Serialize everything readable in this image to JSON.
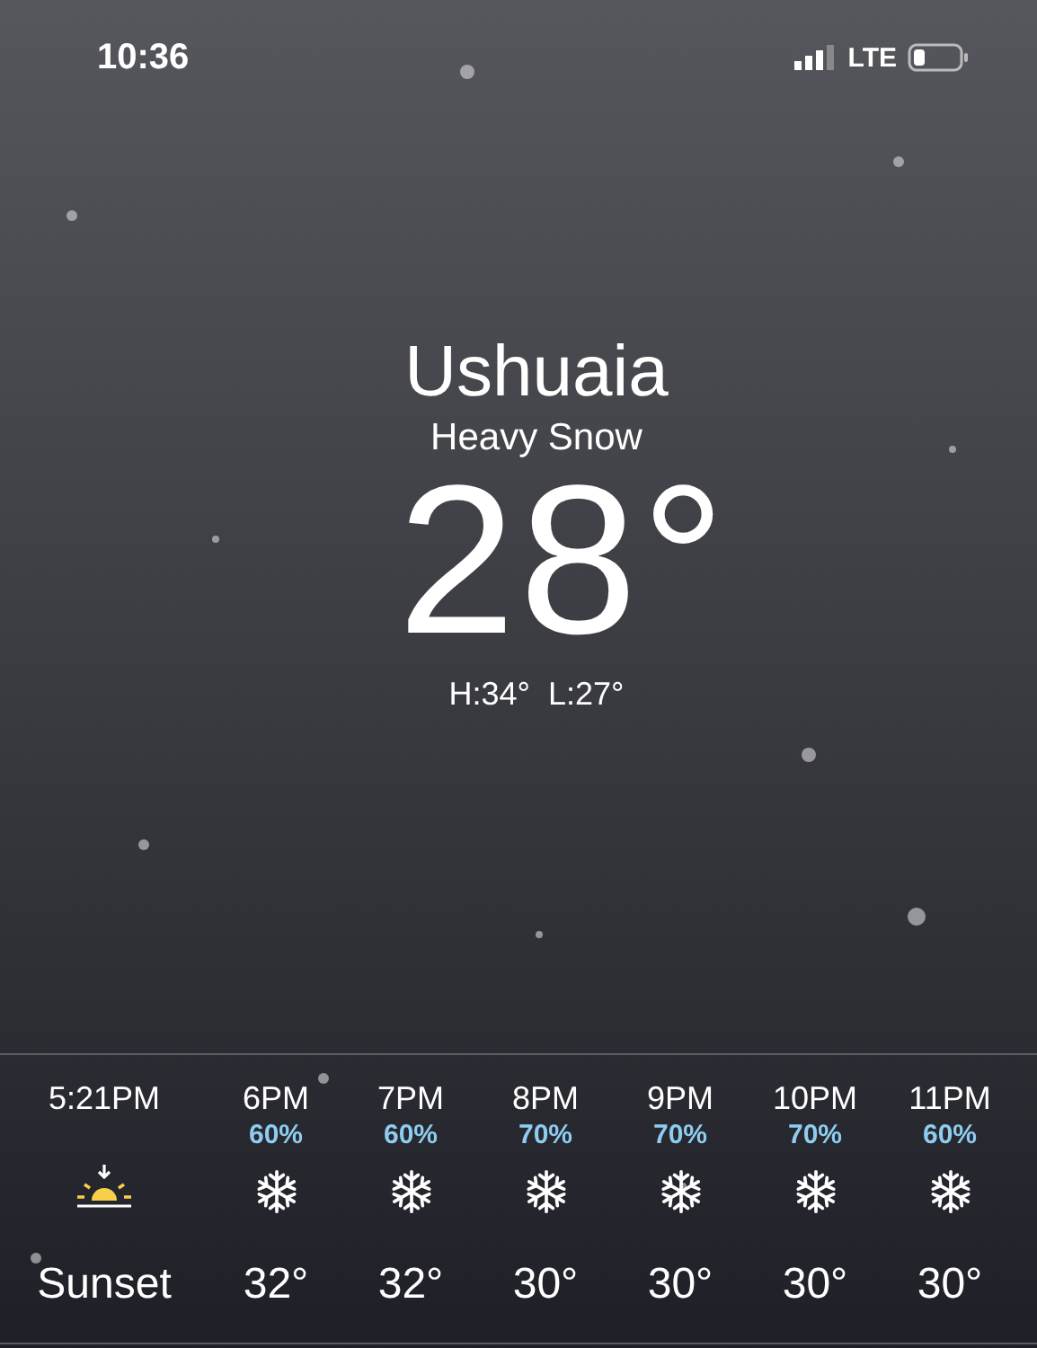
{
  "status_bar": {
    "time": "10:36",
    "network": "LTE"
  },
  "current": {
    "city": "Ushuaia",
    "condition": "Heavy Snow",
    "temperature": "28°",
    "high": "H:34°",
    "low": "L:27°"
  },
  "hourly": [
    {
      "kind": "sunset",
      "time": "5:21PM",
      "label": "Sunset"
    },
    {
      "kind": "hour",
      "time": "6PM",
      "chance": "60%",
      "temp": "32°"
    },
    {
      "kind": "hour",
      "time": "7PM",
      "chance": "60%",
      "temp": "32°"
    },
    {
      "kind": "hour",
      "time": "8PM",
      "chance": "70%",
      "temp": "30°"
    },
    {
      "kind": "hour",
      "time": "9PM",
      "chance": "70%",
      "temp": "30°"
    },
    {
      "kind": "hour",
      "time": "10PM",
      "chance": "70%",
      "temp": "30°"
    },
    {
      "kind": "hour",
      "time": "11PM",
      "chance": "60%",
      "temp": "30°"
    }
  ]
}
